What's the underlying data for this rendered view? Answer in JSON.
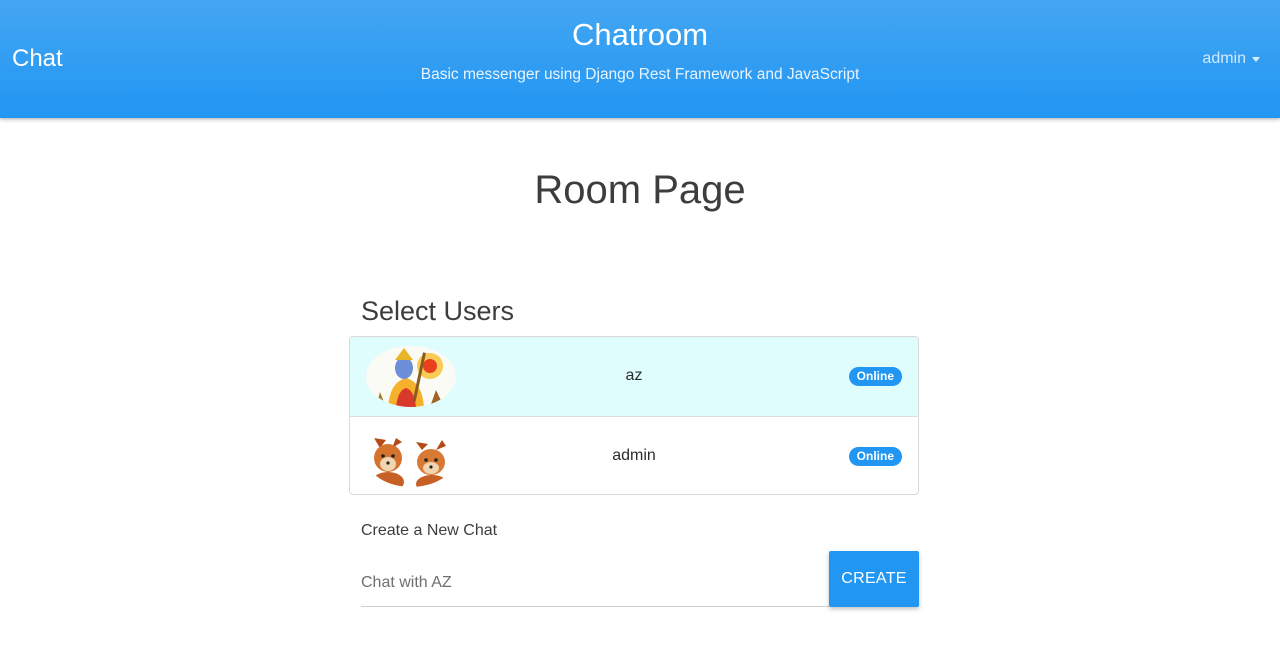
{
  "header": {
    "brand": "Chat",
    "title": "Chatroom",
    "subtitle": "Basic messenger using Django Rest Framework and JavaScript",
    "user_menu": "admin",
    "gradient_top": "#44a6f2",
    "gradient_bottom": "#2196f3"
  },
  "main": {
    "page_title": "Room Page",
    "section_title": "Select Users",
    "users": [
      {
        "name": "az",
        "status": "Online",
        "avatar": "deity-portrait-avatar",
        "selected": true
      },
      {
        "name": "admin",
        "status": "Online",
        "avatar": "fox-kits-avatar",
        "selected": false
      }
    ],
    "create_chat": {
      "label": "Create a New Chat",
      "input_value": "",
      "placeholder": "Chat with AZ",
      "button_label": "CREATE"
    }
  },
  "colors": {
    "accent": "#2196f3",
    "selected_row": "#e0fdfd"
  }
}
